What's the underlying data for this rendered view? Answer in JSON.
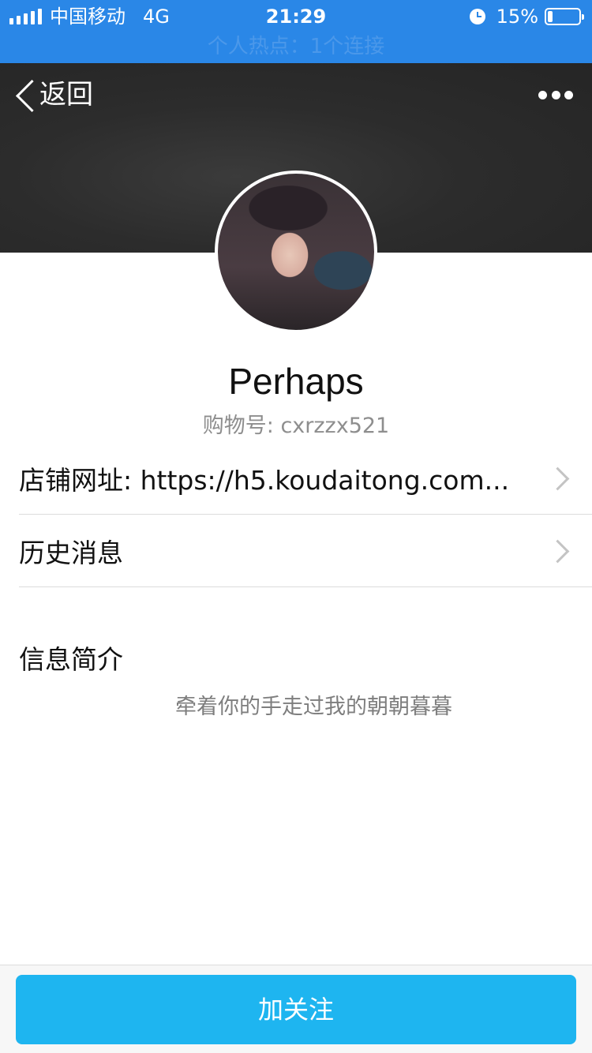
{
  "status_bar": {
    "carrier": "中国移动",
    "network": "4G",
    "time": "21:29",
    "battery_percent": "15%",
    "battery_level": 0.15,
    "hotspot": "个人热点：1个连接",
    "icons": [
      "signal-icon",
      "alarm-icon",
      "battery-icon"
    ]
  },
  "nav": {
    "back_label": "返回",
    "more_icon": "more-dots-icon"
  },
  "profile": {
    "name": "Perhaps",
    "account_id": "购物号: cxrzzx521"
  },
  "rows": [
    {
      "label": "店铺网址: https://h5.koudaitong.com..."
    },
    {
      "label": "历史消息"
    }
  ],
  "intro": {
    "title": "信息简介",
    "text": "牵着你的手走过我的朝朝暮暮"
  },
  "actions": {
    "follow_label": "加关注"
  },
  "colors": {
    "status_bar": "#2a87e7",
    "banner": "#2c2c2c",
    "follow_button": "#1eb5f0"
  }
}
